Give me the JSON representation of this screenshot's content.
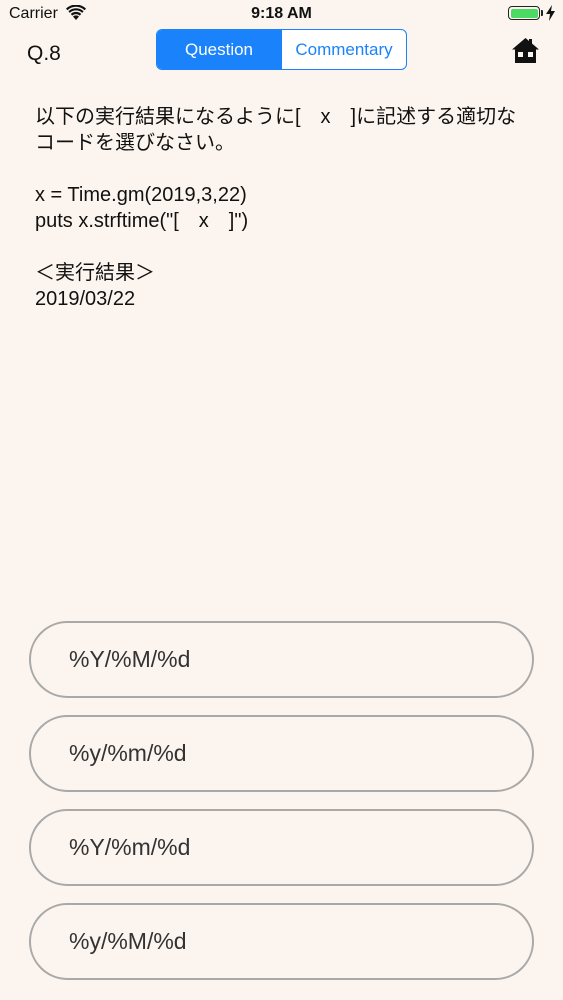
{
  "status_bar": {
    "carrier": "Carrier",
    "time": "9:18 AM",
    "battery_level": 1.0,
    "battery_color": "#4cd964"
  },
  "header": {
    "question_number": "Q.8",
    "tabs": [
      {
        "label": "Question",
        "selected": true
      },
      {
        "label": "Commentary",
        "selected": false
      }
    ],
    "accent_color": "#1a82fb",
    "home_icon": "home-icon"
  },
  "question": {
    "text": "以下の実行結果になるように[　x　]に記述する適切なコードを選びなさい。\n\nx = Time.gm(2019,3,22)\nputs x.strftime(\"[　x　]\")\n\n＜実行結果＞\n2019/03/22"
  },
  "answers": [
    {
      "label": "%Y/%M/%d"
    },
    {
      "label": "%y/%m/%d"
    },
    {
      "label": "%Y/%m/%d"
    },
    {
      "label": "%y/%M/%d"
    }
  ]
}
